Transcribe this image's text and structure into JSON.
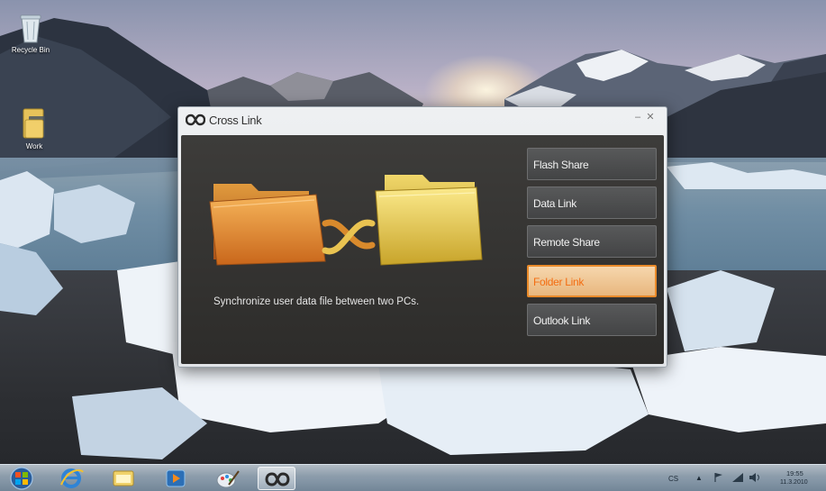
{
  "desktop": {
    "icons": [
      {
        "label": "Recycle Bin",
        "icon": "recycle-bin-icon"
      },
      {
        "label": "Work",
        "icon": "folder-icon"
      }
    ]
  },
  "window": {
    "title": "Cross Link",
    "logo_icon": "infinity-link-icon",
    "minimize_label": "–",
    "close_label": "✕",
    "description": "Synchronize user data file between two PCs.",
    "illustration_icons": [
      "orange-folder-icon",
      "link-arrows-icon",
      "yellow-folder-icon"
    ],
    "menu": [
      {
        "label": "Flash Share",
        "active": false
      },
      {
        "label": "Data Link",
        "active": false
      },
      {
        "label": "Remote Share",
        "active": false
      },
      {
        "label": "Folder Link",
        "active": true
      },
      {
        "label": "Outlook Link",
        "active": false
      }
    ],
    "colors": {
      "accent": "#e98a2a",
      "active_text": "#f36d12",
      "panel": "#353432"
    }
  },
  "taskbar": {
    "items": [
      "start-orb-icon",
      "internet-explorer-icon",
      "file-explorer-icon",
      "media-player-icon",
      "paint-icon",
      "cross-link-app-icon"
    ],
    "tray": {
      "language": "CS",
      "time": "19:55",
      "date": "11.3.2010"
    }
  }
}
